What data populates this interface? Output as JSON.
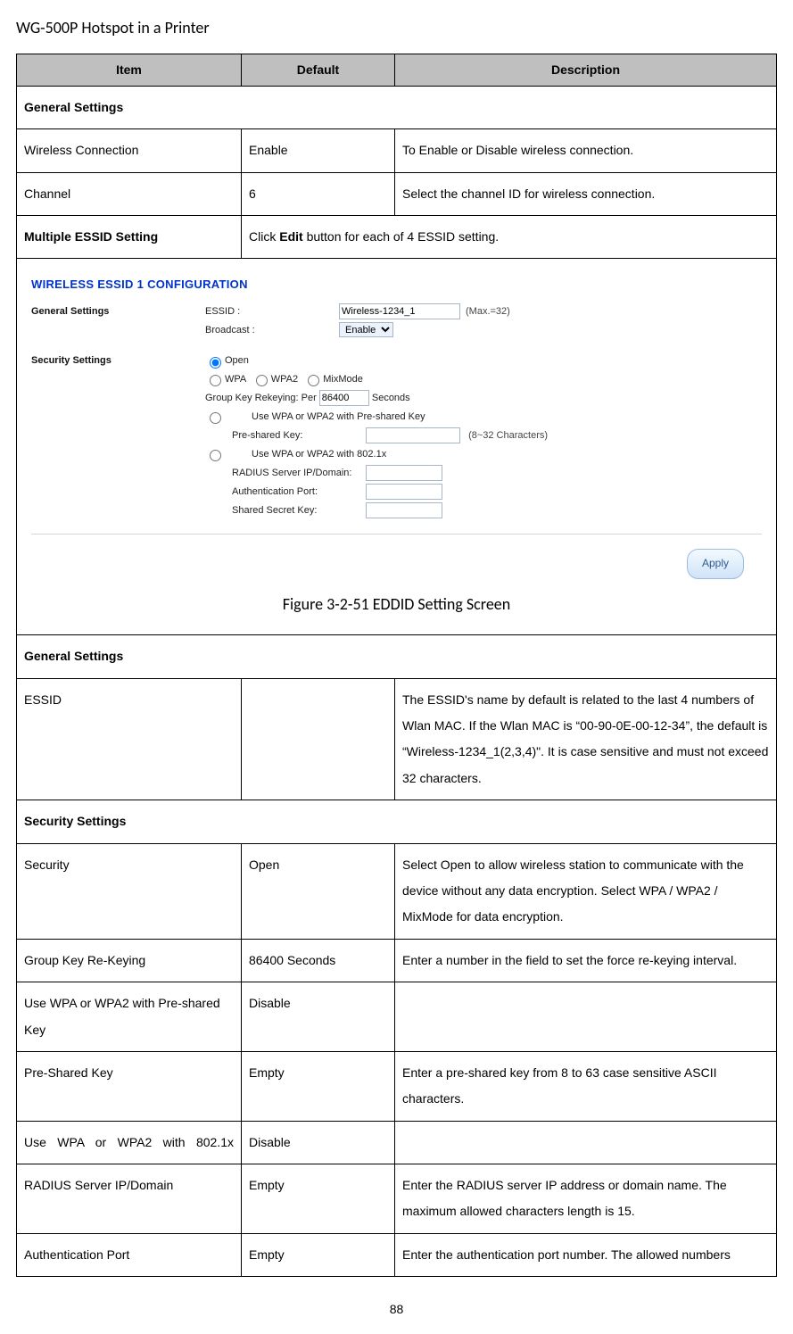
{
  "doc_title": "WG-500P Hotspot in a Printer",
  "page_number": "88",
  "figure_caption": "Figure 3-2-51 EDDID Setting Screen",
  "headers": {
    "item": "Item",
    "default": "Default",
    "desc": "Description"
  },
  "rows": {
    "gs1_header": "General Settings",
    "wc": {
      "item": "Wireless Connection",
      "def": "Enable",
      "desc": "To Enable or Disable wireless connection."
    },
    "ch": {
      "item": "Channel",
      "def": "6",
      "desc": "Select the channel ID for wireless connection."
    },
    "mes": {
      "item": "Multiple ESSID Setting",
      "desc_pre": "Click ",
      "desc_b": "Edit",
      "desc_post": " button for each of 4 ESSID setting."
    },
    "gs2_header": "General Settings",
    "essid": {
      "item": "ESSID",
      "def": "",
      "desc": "The ESSID's name by default is related to the last 4 numbers of Wlan MAC. If the Wlan MAC is “00-90-0E-00-12-34”, the default is “Wireless-1234_1(2,3,4)\". It is case sensitive and must not exceed 32 characters."
    },
    "ss_header": "Security Settings",
    "sec": {
      "item": "Security",
      "def": "Open",
      "desc": "Select Open to allow wireless station to communicate with the device without any data encryption. Select WPA / WPA2 / MixMode for data encryption."
    },
    "gkr": {
      "item": "Group Key Re-Keying",
      "def": "86400 Seconds",
      "desc": "Enter a number in the field to set the force re-keying interval."
    },
    "psk_mode": {
      "item": "Use WPA or WPA2 with Pre-shared Key",
      "def": "Disable",
      "desc": ""
    },
    "psk": {
      "item": "Pre-Shared Key",
      "def": "Empty",
      "desc": "Enter a pre-shared key from 8 to 63 case sensitive ASCII characters."
    },
    "d1x": {
      "item": "Use WPA or WPA2 with 802.1x",
      "def": "Disable",
      "desc": ""
    },
    "rad": {
      "item": "RADIUS Server IP/Domain",
      "def": "Empty",
      "desc": "Enter the RADIUS server IP address or domain name. The maximum allowed characters length is 15."
    },
    "auth": {
      "item": "Authentication Port",
      "def": "Empty",
      "desc": "Enter the authentication port number. The allowed numbers"
    }
  },
  "cfg": {
    "title": "WIRELESS ESSID 1 CONFIGURATION",
    "gs_label": "General Settings",
    "ss_label": "Security Settings",
    "essid_label": "ESSID :",
    "essid_value": "Wireless-1234_1",
    "essid_hint": "(Max.=32)",
    "broadcast_label": "Broadcast :",
    "broadcast_value": "Enable",
    "open": "Open",
    "wpa": "WPA",
    "wpa2": "WPA2",
    "mix": "MixMode",
    "gkr_label": "Group Key Rekeying: Per",
    "gkr_value": "86400",
    "gkr_unit": "Seconds",
    "use_psk": "Use WPA or WPA2 with Pre-shared Key",
    "psk_label": "Pre-shared Key:",
    "psk_hint": "(8~32 Characters)",
    "use_1x": "Use WPA or WPA2 with 802.1x",
    "rad_label": "RADIUS Server IP/Domain:",
    "auth_label": "Authentication Port:",
    "secret_label": "Shared Secret Key:",
    "apply": "Apply"
  }
}
